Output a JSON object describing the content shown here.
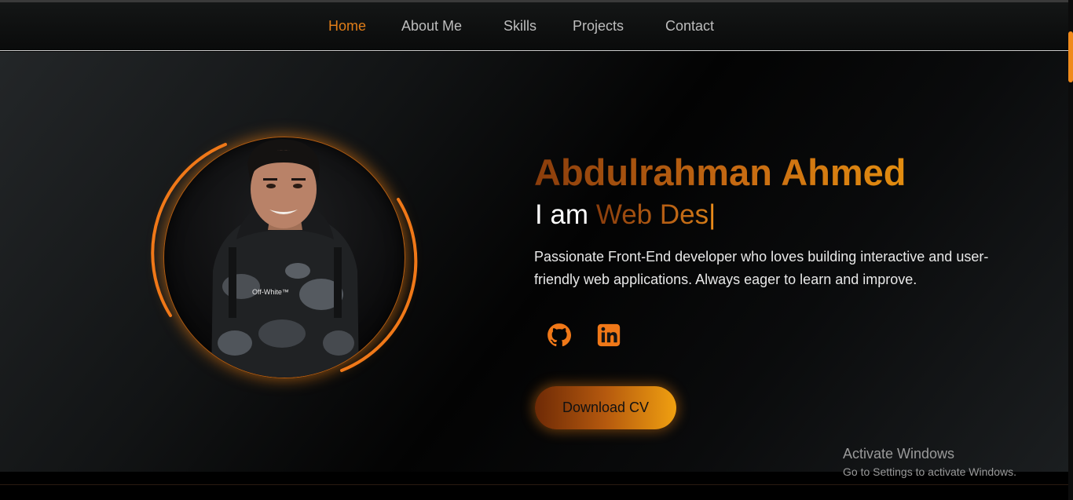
{
  "nav": {
    "items": [
      {
        "label": "Home",
        "active": true
      },
      {
        "label": "About Me",
        "active": false
      },
      {
        "label": "Skills",
        "active": false
      },
      {
        "label": "Projects",
        "active": false
      },
      {
        "label": "Contact",
        "active": false
      }
    ]
  },
  "hero": {
    "name": "Abdulrahman Ahmed",
    "typing_prefix": "I am",
    "typing_role": "Web Des",
    "typing_cursor": "|",
    "bio": "Passionate Front-End developer who loves building interactive and user-friendly web applications. Always eager to learn and improve.",
    "social": [
      {
        "icon": "github-icon"
      },
      {
        "icon": "linkedin-icon"
      }
    ],
    "cv_button": "Download CV",
    "profile_shirt_text": "Off-White™"
  },
  "watermark": {
    "title": "Activate Windows",
    "subtitle": "Go to Settings to activate Windows."
  },
  "colors": {
    "accent": "#f08a1c",
    "accent_dark": "#8a3d0c",
    "background": "#000000",
    "text": "#e9e9e9",
    "nav_text": "#bdbdbd"
  }
}
